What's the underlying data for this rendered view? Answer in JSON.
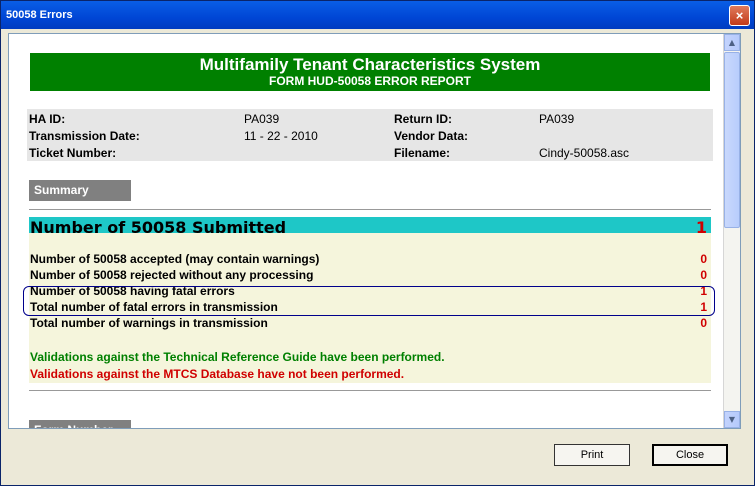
{
  "window": {
    "title": "50058 Errors",
    "close_glyph": "×"
  },
  "banner": {
    "title": "Multifamily Tenant Characteristics System",
    "subtitle": "FORM HUD-50058 ERROR REPORT"
  },
  "info": {
    "ha_id_label": "HA ID:",
    "ha_id_value": "PA039",
    "transmission_date_label": "Transmission Date:",
    "transmission_date_value": "11 - 22 - 2010",
    "ticket_number_label": "Ticket Number:",
    "ticket_number_value": "",
    "return_id_label": "Return ID:",
    "return_id_value": "PA039",
    "vendor_data_label": "Vendor Data:",
    "vendor_data_value": "",
    "filename_label": "Filename:",
    "filename_value": "Cindy-50058.asc"
  },
  "summary_header": "Summary",
  "summary": {
    "submitted_label": "Number of 50058 Submitted",
    "submitted_value": "1",
    "rows": [
      {
        "label": "Number of 50058 accepted (may contain warnings)",
        "value": "0"
      },
      {
        "label": "Number of 50058 rejected without any processing",
        "value": "0"
      },
      {
        "label": "Number of 50058 having fatal errors",
        "value": "1"
      },
      {
        "label": "Total number of fatal errors in transmission",
        "value": "1"
      },
      {
        "label": "Total number of warnings in transmission",
        "value": "0"
      }
    ],
    "message_green": "Validations against the Technical Reference Guide have been performed.",
    "message_red": "Validations against the MTCS Database have not been performed."
  },
  "next_section_header": "Form Number",
  "buttons": {
    "print": "Print",
    "close": "Close"
  },
  "colors": {
    "banner": "#008000",
    "cyan_row": "#1ec7c7",
    "error_red": "#d00000",
    "ok_green": "#008000"
  }
}
